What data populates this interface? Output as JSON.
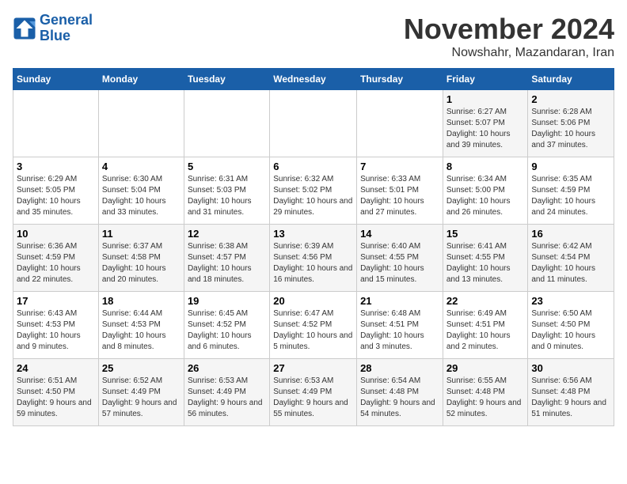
{
  "logo": {
    "line1": "General",
    "line2": "Blue"
  },
  "title": "November 2024",
  "subtitle": "Nowshahr, Mazandaran, Iran",
  "days_of_week": [
    "Sunday",
    "Monday",
    "Tuesday",
    "Wednesday",
    "Thursday",
    "Friday",
    "Saturday"
  ],
  "weeks": [
    [
      {
        "day": "",
        "info": ""
      },
      {
        "day": "",
        "info": ""
      },
      {
        "day": "",
        "info": ""
      },
      {
        "day": "",
        "info": ""
      },
      {
        "day": "",
        "info": ""
      },
      {
        "day": "1",
        "info": "Sunrise: 6:27 AM\nSunset: 5:07 PM\nDaylight: 10 hours and 39 minutes."
      },
      {
        "day": "2",
        "info": "Sunrise: 6:28 AM\nSunset: 5:06 PM\nDaylight: 10 hours and 37 minutes."
      }
    ],
    [
      {
        "day": "3",
        "info": "Sunrise: 6:29 AM\nSunset: 5:05 PM\nDaylight: 10 hours and 35 minutes."
      },
      {
        "day": "4",
        "info": "Sunrise: 6:30 AM\nSunset: 5:04 PM\nDaylight: 10 hours and 33 minutes."
      },
      {
        "day": "5",
        "info": "Sunrise: 6:31 AM\nSunset: 5:03 PM\nDaylight: 10 hours and 31 minutes."
      },
      {
        "day": "6",
        "info": "Sunrise: 6:32 AM\nSunset: 5:02 PM\nDaylight: 10 hours and 29 minutes."
      },
      {
        "day": "7",
        "info": "Sunrise: 6:33 AM\nSunset: 5:01 PM\nDaylight: 10 hours and 27 minutes."
      },
      {
        "day": "8",
        "info": "Sunrise: 6:34 AM\nSunset: 5:00 PM\nDaylight: 10 hours and 26 minutes."
      },
      {
        "day": "9",
        "info": "Sunrise: 6:35 AM\nSunset: 4:59 PM\nDaylight: 10 hours and 24 minutes."
      }
    ],
    [
      {
        "day": "10",
        "info": "Sunrise: 6:36 AM\nSunset: 4:59 PM\nDaylight: 10 hours and 22 minutes."
      },
      {
        "day": "11",
        "info": "Sunrise: 6:37 AM\nSunset: 4:58 PM\nDaylight: 10 hours and 20 minutes."
      },
      {
        "day": "12",
        "info": "Sunrise: 6:38 AM\nSunset: 4:57 PM\nDaylight: 10 hours and 18 minutes."
      },
      {
        "day": "13",
        "info": "Sunrise: 6:39 AM\nSunset: 4:56 PM\nDaylight: 10 hours and 16 minutes."
      },
      {
        "day": "14",
        "info": "Sunrise: 6:40 AM\nSunset: 4:55 PM\nDaylight: 10 hours and 15 minutes."
      },
      {
        "day": "15",
        "info": "Sunrise: 6:41 AM\nSunset: 4:55 PM\nDaylight: 10 hours and 13 minutes."
      },
      {
        "day": "16",
        "info": "Sunrise: 6:42 AM\nSunset: 4:54 PM\nDaylight: 10 hours and 11 minutes."
      }
    ],
    [
      {
        "day": "17",
        "info": "Sunrise: 6:43 AM\nSunset: 4:53 PM\nDaylight: 10 hours and 9 minutes."
      },
      {
        "day": "18",
        "info": "Sunrise: 6:44 AM\nSunset: 4:53 PM\nDaylight: 10 hours and 8 minutes."
      },
      {
        "day": "19",
        "info": "Sunrise: 6:45 AM\nSunset: 4:52 PM\nDaylight: 10 hours and 6 minutes."
      },
      {
        "day": "20",
        "info": "Sunrise: 6:47 AM\nSunset: 4:52 PM\nDaylight: 10 hours and 5 minutes."
      },
      {
        "day": "21",
        "info": "Sunrise: 6:48 AM\nSunset: 4:51 PM\nDaylight: 10 hours and 3 minutes."
      },
      {
        "day": "22",
        "info": "Sunrise: 6:49 AM\nSunset: 4:51 PM\nDaylight: 10 hours and 2 minutes."
      },
      {
        "day": "23",
        "info": "Sunrise: 6:50 AM\nSunset: 4:50 PM\nDaylight: 10 hours and 0 minutes."
      }
    ],
    [
      {
        "day": "24",
        "info": "Sunrise: 6:51 AM\nSunset: 4:50 PM\nDaylight: 9 hours and 59 minutes."
      },
      {
        "day": "25",
        "info": "Sunrise: 6:52 AM\nSunset: 4:49 PM\nDaylight: 9 hours and 57 minutes."
      },
      {
        "day": "26",
        "info": "Sunrise: 6:53 AM\nSunset: 4:49 PM\nDaylight: 9 hours and 56 minutes."
      },
      {
        "day": "27",
        "info": "Sunrise: 6:53 AM\nSunset: 4:49 PM\nDaylight: 9 hours and 55 minutes."
      },
      {
        "day": "28",
        "info": "Sunrise: 6:54 AM\nSunset: 4:48 PM\nDaylight: 9 hours and 54 minutes."
      },
      {
        "day": "29",
        "info": "Sunrise: 6:55 AM\nSunset: 4:48 PM\nDaylight: 9 hours and 52 minutes."
      },
      {
        "day": "30",
        "info": "Sunrise: 6:56 AM\nSunset: 4:48 PM\nDaylight: 9 hours and 51 minutes."
      }
    ]
  ]
}
